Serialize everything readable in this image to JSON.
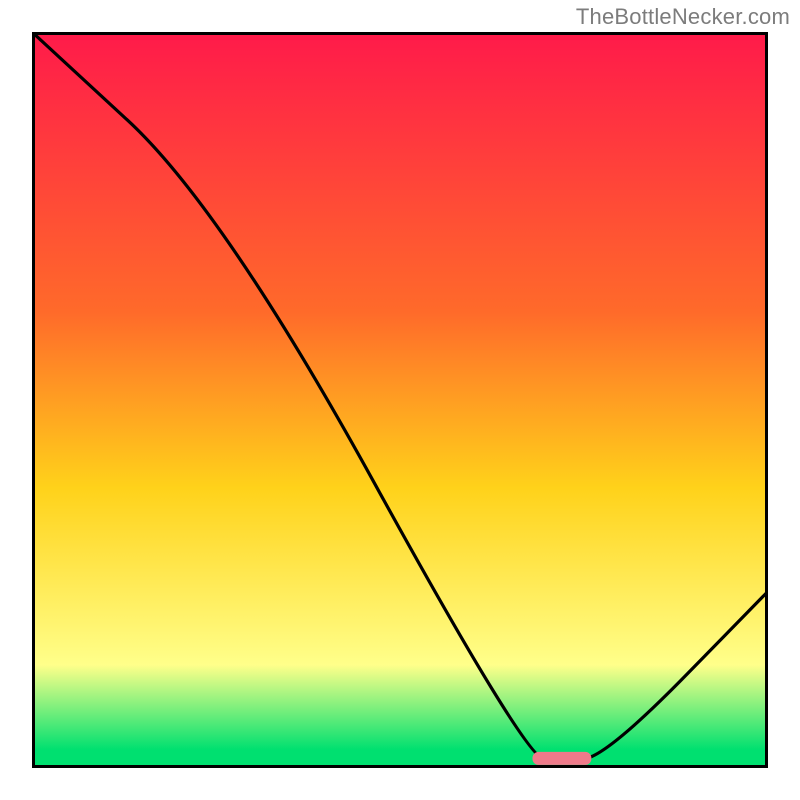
{
  "attribution": "TheBottleNecker.com",
  "colors": {
    "top": "#ff1a4a",
    "upper": "#ff6a2a",
    "mid": "#ffd21a",
    "lower": "#ffff8a",
    "bottom": "#00e070",
    "marker": "#ef7a8a",
    "frame": "#000000",
    "line": "#000000",
    "attribution_text": "#7c7c7c"
  },
  "chart_data": {
    "type": "line",
    "title": "",
    "xlabel": "",
    "ylabel": "",
    "xlim": [
      0,
      100
    ],
    "ylim": [
      0,
      100
    ],
    "grid": false,
    "legend": false,
    "background_gradient_stops": [
      {
        "pos": 0.0,
        "color_key": "top"
      },
      {
        "pos": 0.38,
        "color_key": "upper"
      },
      {
        "pos": 0.62,
        "color_key": "mid"
      },
      {
        "pos": 0.86,
        "color_key": "lower"
      },
      {
        "pos": 0.975,
        "color_key": "bottom"
      },
      {
        "pos": 1.0,
        "color_key": "bottom"
      }
    ],
    "series": [
      {
        "name": "bottleneck-curve",
        "x": [
          0,
          26,
          67,
          72,
          78,
          100
        ],
        "values": [
          100,
          76,
          1.5,
          1,
          1.5,
          24
        ]
      }
    ],
    "marker": {
      "name": "optimum-marker",
      "x_center": 72,
      "x_halfwidth": 4,
      "y": 1.3,
      "shape": "pill"
    }
  }
}
